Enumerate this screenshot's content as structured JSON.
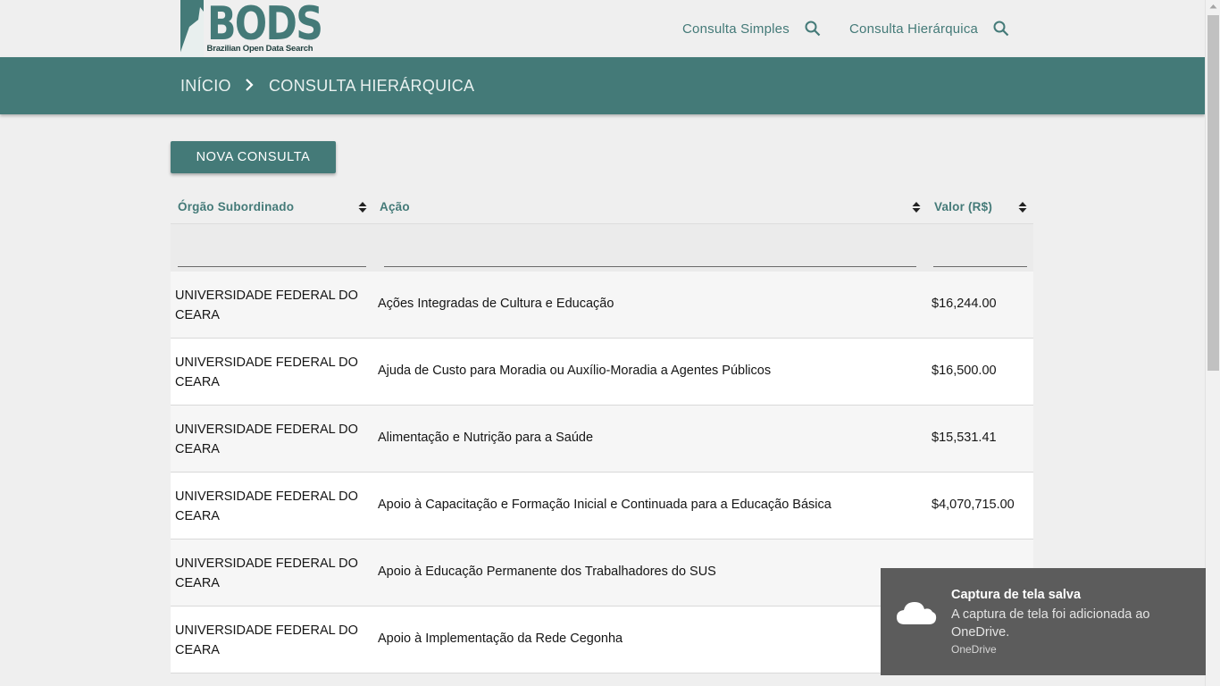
{
  "header": {
    "logo_word": "BODS",
    "logo_subtitle": "Brazilian Open Data Search",
    "nav": [
      {
        "label": "Consulta Simples",
        "icon": "search-icon"
      },
      {
        "label": "Consulta Hierárquica",
        "icon": "search-icon"
      }
    ]
  },
  "breadcrumb": {
    "items": [
      "INÍCIO",
      "CONSULTA HIERÁRQUICA"
    ],
    "separator_icon": "chevron-right-icon"
  },
  "actions": {
    "new_query_label": "NOVA CONSULTA"
  },
  "table": {
    "columns": [
      {
        "label": "Órgão Subordinado",
        "sort_icon": "sort-icon"
      },
      {
        "label": "Ação",
        "sort_icon": "sort-icon"
      },
      {
        "label": "Valor (R$)",
        "sort_icon": "sort-icon"
      }
    ],
    "filters": [
      "",
      "",
      ""
    ],
    "rows": [
      {
        "orgao": "UNIVERSIDADE FEDERAL DO CEARA",
        "acao": "Ações Integradas de Cultura e Educação",
        "valor": "$16,244.00"
      },
      {
        "orgao": "UNIVERSIDADE FEDERAL DO CEARA",
        "acao": "Ajuda de Custo para Moradia ou Auxílio-Moradia a Agentes Públicos",
        "valor": "$16,500.00"
      },
      {
        "orgao": "UNIVERSIDADE FEDERAL DO CEARA",
        "acao": "Alimentação e Nutrição para a Saúde",
        "valor": "$15,531.41"
      },
      {
        "orgao": "UNIVERSIDADE FEDERAL DO CEARA",
        "acao": "Apoio à Capacitação e Formação Inicial e Continuada para a Educação Básica",
        "valor": "$4,070,715.00"
      },
      {
        "orgao": "UNIVERSIDADE FEDERAL DO CEARA",
        "acao": "Apoio à Educação Permanente dos Trabalhadores do SUS",
        "valor": ""
      },
      {
        "orgao": "UNIVERSIDADE FEDERAL DO CEARA",
        "acao": "Apoio à Implementação da Rede Cegonha",
        "valor": ""
      }
    ]
  },
  "toast": {
    "icon": "cloud-icon",
    "title": "Captura de tela salva",
    "body": "A captura de tela foi adicionada ao OneDrive.",
    "source": "OneDrive"
  },
  "colors": {
    "brand": "#447a78",
    "background": "#efefef",
    "toast": "#5c5c5c"
  }
}
